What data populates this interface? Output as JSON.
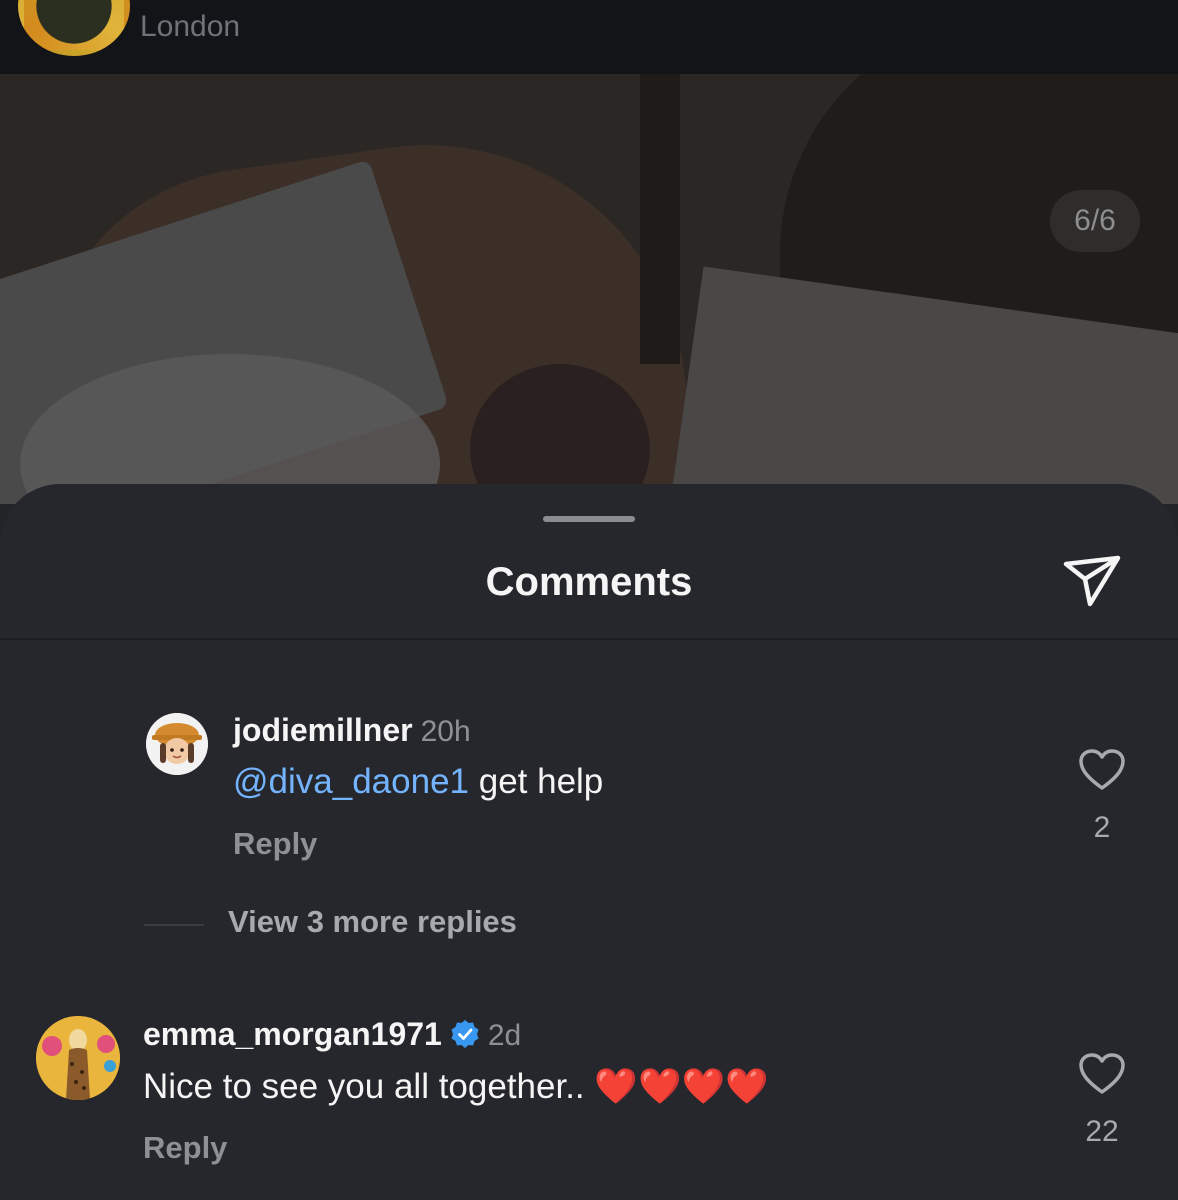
{
  "post": {
    "location": "London",
    "media_counter": "6/6"
  },
  "sheet": {
    "title": "Comments"
  },
  "comments": [
    {
      "username": "jodiemillner",
      "time": "20h",
      "mention": "@diva_daone1",
      "text": " get help",
      "reply_label": "Reply",
      "likes": "2",
      "view_more": "View 3 more replies"
    },
    {
      "username": "emma_morgan1971",
      "verified": true,
      "time": "2d",
      "text": "Nice to see you all together.. ❤️❤️❤️❤️",
      "reply_label": "Reply",
      "likes": "22"
    }
  ],
  "colors": {
    "mention": "#74b4ff",
    "verified": "#3897f0",
    "heart_emoji": "#e0202a"
  },
  "icons": [
    "send-icon",
    "heart-outline-icon",
    "verified-badge-icon"
  ]
}
